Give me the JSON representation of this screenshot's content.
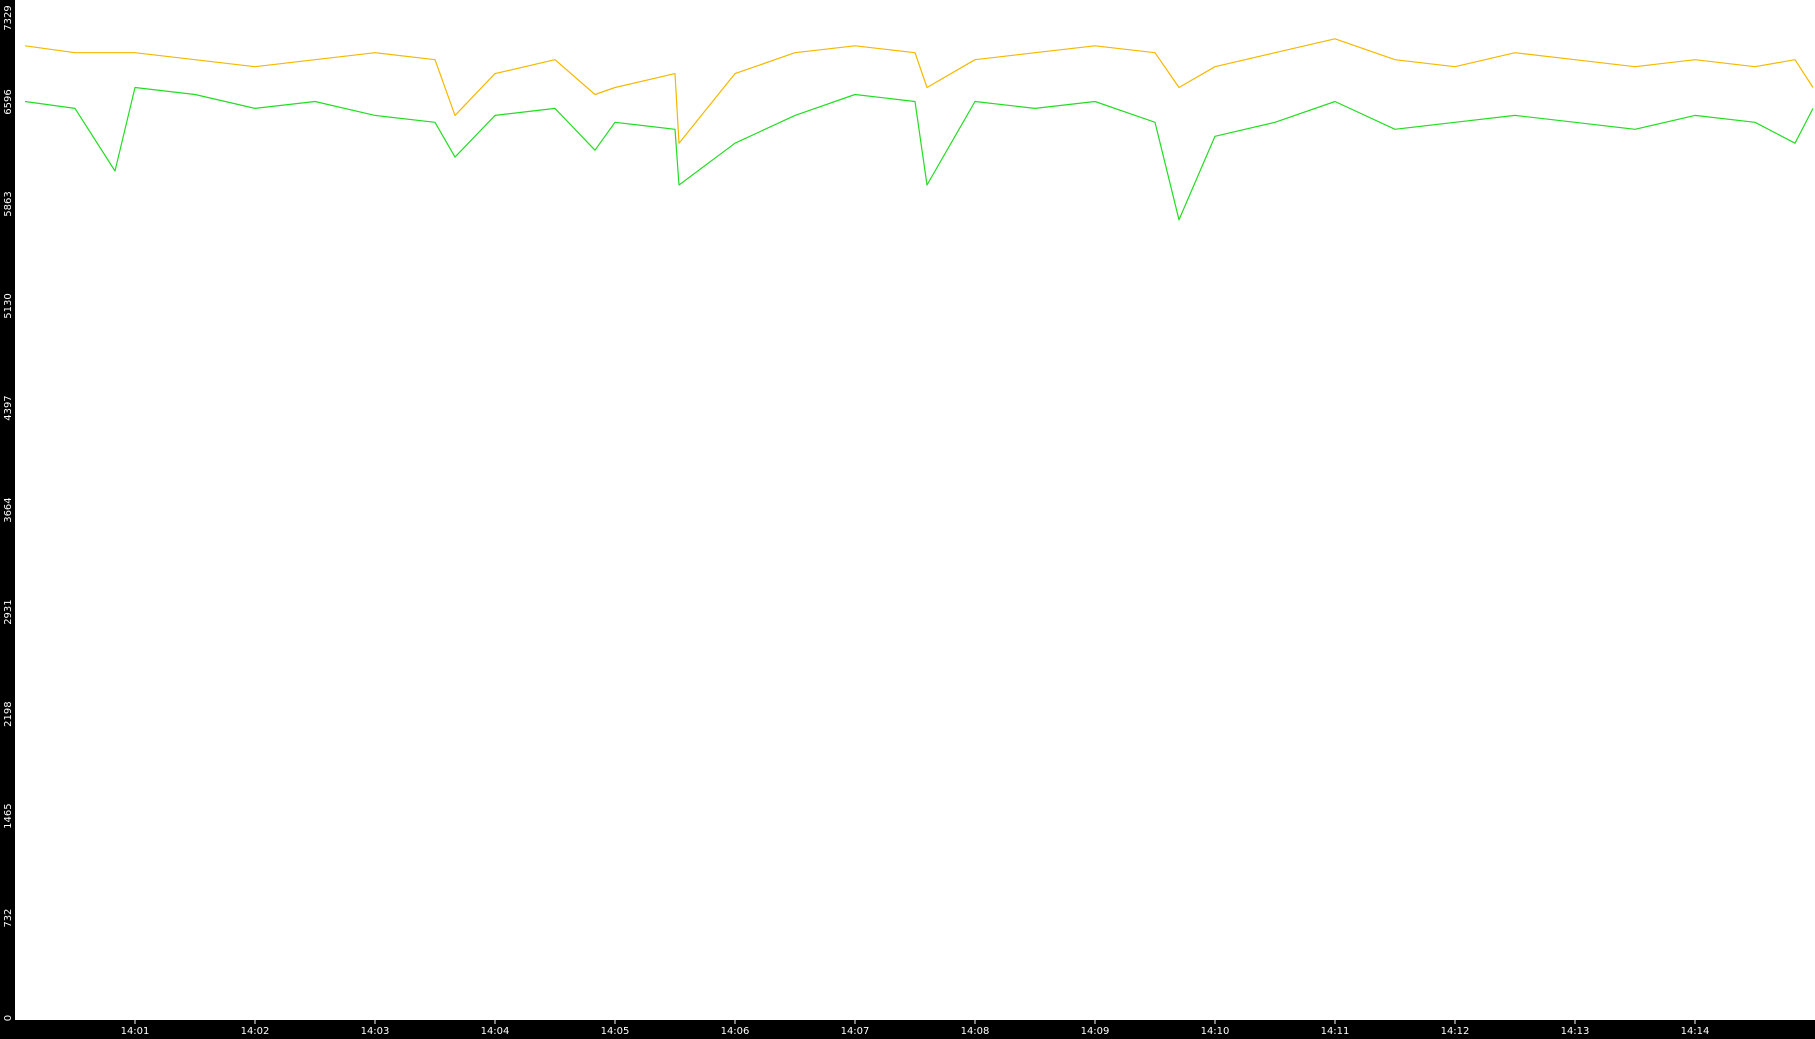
{
  "chart_data": {
    "type": "line",
    "title": "",
    "xlabel": "",
    "ylabel": "",
    "ylim": [
      0,
      7329
    ],
    "y_ticks": [
      0,
      732,
      1465,
      2198,
      2931,
      3664,
      4397,
      5130,
      5863,
      6596,
      7329
    ],
    "x_range": [
      "14:00",
      "14:15"
    ],
    "x_ticks": [
      "14:01",
      "14:02",
      "14:03",
      "14:04",
      "14:05",
      "14:06",
      "14:07",
      "14:08",
      "14:09",
      "14:10",
      "14:11",
      "14:12",
      "14:13",
      "14:14"
    ],
    "grid": false,
    "series": [
      {
        "color": "#f5b800",
        "x": [
          "14:00:05",
          "14:00:30",
          "14:01:00",
          "14:01:30",
          "14:02:00",
          "14:02:30",
          "14:03:00",
          "14:03:30",
          "14:03:40",
          "14:04:00",
          "14:04:30",
          "14:04:50",
          "14:05:00",
          "14:05:30",
          "14:05:32",
          "14:06:00",
          "14:06:30",
          "14:07:00",
          "14:07:30",
          "14:07:36",
          "14:08:00",
          "14:08:30",
          "14:09:00",
          "14:09:30",
          "14:09:42",
          "14:10:00",
          "14:10:30",
          "14:11:00",
          "14:11:30",
          "14:12:00",
          "14:12:30",
          "14:13:00",
          "14:13:30",
          "14:14:00",
          "14:14:30",
          "14:14:50",
          "14:14:59"
        ],
        "y": [
          7000,
          6950,
          6950,
          6900,
          6850,
          6900,
          6950,
          6900,
          6500,
          6800,
          6900,
          6650,
          6700,
          6800,
          6300,
          6800,
          6950,
          7000,
          6950,
          6700,
          6900,
          6950,
          7000,
          6950,
          6700,
          6850,
          6950,
          7050,
          6900,
          6850,
          6950,
          6900,
          6850,
          6900,
          6850,
          6900,
          6700
        ]
      },
      {
        "color": "#22dd22",
        "x": [
          "14:00:05",
          "14:00:30",
          "14:00:50",
          "14:01:00",
          "14:01:30",
          "14:02:00",
          "14:02:30",
          "14:03:00",
          "14:03:30",
          "14:03:40",
          "14:04:00",
          "14:04:30",
          "14:04:50",
          "14:05:00",
          "14:05:30",
          "14:05:32",
          "14:06:00",
          "14:06:30",
          "14:07:00",
          "14:07:30",
          "14:07:36",
          "14:08:00",
          "14:08:30",
          "14:09:00",
          "14:09:30",
          "14:09:42",
          "14:10:00",
          "14:10:30",
          "14:11:00",
          "14:11:30",
          "14:12:00",
          "14:12:30",
          "14:13:00",
          "14:13:30",
          "14:14:00",
          "14:14:30",
          "14:14:50",
          "14:14:59"
        ],
        "y": [
          6600,
          6550,
          6100,
          6700,
          6650,
          6550,
          6600,
          6500,
          6450,
          6200,
          6500,
          6550,
          6250,
          6450,
          6400,
          6000,
          6300,
          6500,
          6650,
          6600,
          6000,
          6600,
          6550,
          6600,
          6450,
          5750,
          6350,
          6450,
          6600,
          6400,
          6450,
          6500,
          6450,
          6400,
          6500,
          6450,
          6300,
          6550
        ]
      }
    ]
  }
}
